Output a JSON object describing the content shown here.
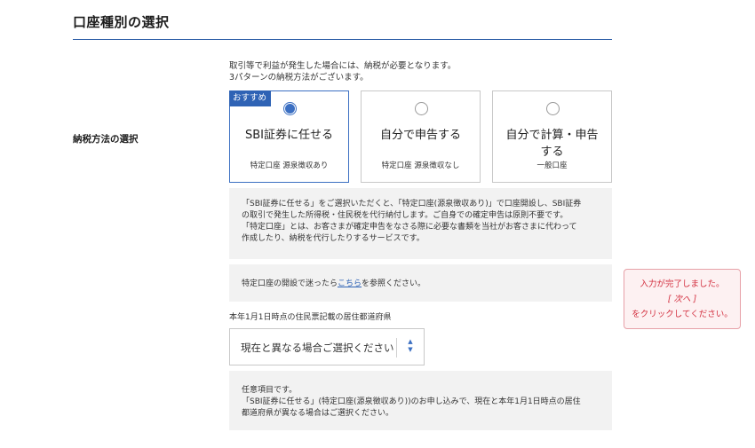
{
  "section": {
    "title": "口座種別の選択"
  },
  "intro": {
    "line1": "取引等で利益が発生した場合には、納税が必要となります。",
    "line2": "3パターンの納税方法がございます。"
  },
  "tax_method": {
    "label": "納税方法の選択",
    "options": [
      {
        "badge": "おすすめ",
        "title": "SBI証券に任せる",
        "sub": "特定口座 源泉徴収あり",
        "selected": true
      },
      {
        "title": "自分で申告する",
        "sub": "特定口座 源泉徴収なし",
        "selected": false
      },
      {
        "title_line1": "自分で計算・申告",
        "title_line2": "する",
        "sub": "一般口座",
        "selected": false
      }
    ]
  },
  "info1": {
    "line1": "「SBI証券に任せる」をご選択いただくと、「特定口座(源泉徴収あり)」で口座開設し、SBI証券",
    "line2": "の取引で発生した所得税・住民税を代行納付します。ご自身での確定申告は原則不要です。",
    "line3": "「特定口座」とは、お客さまが確定申告をなさる際に必要な書類を当社がお客さまに代わって",
    "line4": "作成したり、納税を代行したりするサービスです。"
  },
  "info2": {
    "before": "特定口座の開設で迷ったら",
    "link": "こちら",
    "after": "を参照ください。"
  },
  "prefecture": {
    "label": "本年1月1日時点の住民票記載の居住都道府県",
    "select_value": "現在と異なる場合ご選択ください"
  },
  "info3": {
    "line1": "任意項目です。",
    "line2": "「SBI証券に任せる」(特定口座(源泉徴収あり))のお申し込みで、現在と本年1月1日時点の居住",
    "line3": "都道府県が異なる場合はご選択ください。"
  },
  "notice": {
    "line1": "入力が完了しました。",
    "line2": "[ 次へ ]",
    "line3": "をクリックしてください。"
  },
  "colors": {
    "accent": "#2f63b5",
    "notice_text": "#d32f3f",
    "notice_border": "#e7a1a8"
  }
}
